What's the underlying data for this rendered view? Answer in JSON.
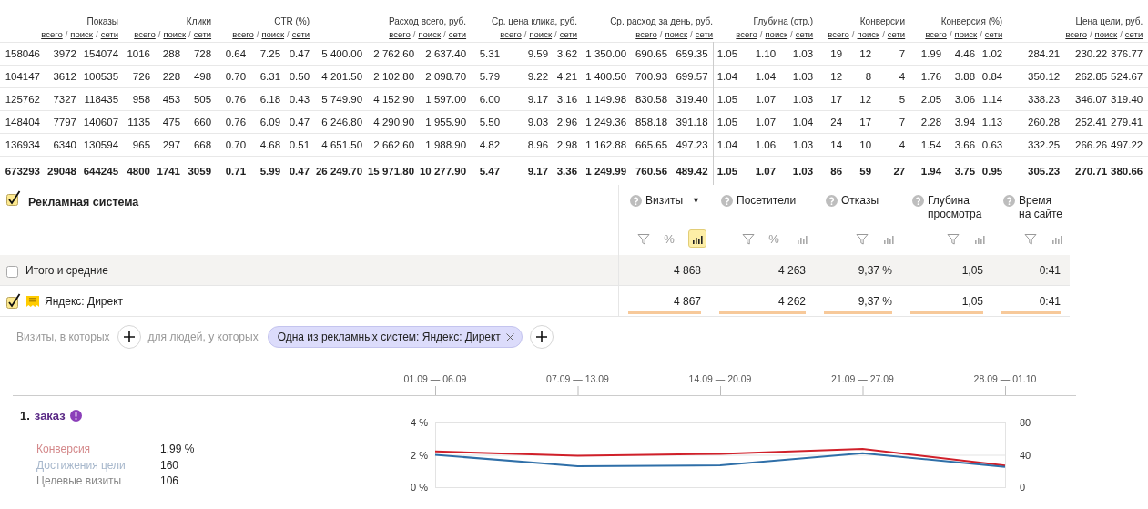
{
  "top_table": {
    "groups": [
      {
        "title": "Показы",
        "links": [
          "всего",
          "поиск",
          "сети"
        ],
        "separators": [
          "/",
          "/"
        ]
      },
      {
        "title": "Клики",
        "links": [
          "всего",
          "поиск",
          "сети"
        ],
        "separators": [
          "/",
          "/"
        ]
      },
      {
        "title": "CTR (%)",
        "links": [
          "всего",
          "поиск",
          "сети"
        ],
        "separators": [
          "/",
          "/"
        ]
      },
      {
        "title": "Расход всего, руб.",
        "links": [
          "всего",
          "поиск",
          "сети"
        ],
        "separators": [
          "/",
          "/"
        ]
      },
      {
        "title": "Ср. цена клика, руб.",
        "links": [
          "всего",
          "поиск",
          "сети"
        ],
        "separators": [
          "/",
          "/"
        ]
      },
      {
        "title": "Ср. расход за день, руб.",
        "links": [
          "всего",
          "поиск",
          "сети"
        ],
        "separators": [
          "/",
          "/"
        ]
      },
      {
        "title": "Глубина (стр.)",
        "links": [
          "всего",
          "поиск",
          "сети"
        ],
        "separators": [
          "/",
          "/"
        ]
      },
      {
        "title": "Конверсии",
        "links": [
          "всего",
          "поиск",
          "сети"
        ],
        "separators": [
          "/",
          "/"
        ]
      },
      {
        "title": "Конверсия (%)",
        "links": [
          "всего",
          "поиск",
          "сети"
        ],
        "separators": [
          "/",
          "/"
        ]
      },
      {
        "title": "Цена цели, руб.",
        "links": [
          "всего",
          "поиск",
          "сети"
        ],
        "separators": [
          "/",
          "/"
        ]
      }
    ],
    "rows": [
      {
        "kind": "data",
        "cells": [
          "158046",
          "3972",
          "154074",
          "1016",
          "288",
          "728",
          "0.64",
          "7.25",
          "0.47",
          "5 400.00",
          "2 762.60",
          "2 637.40",
          "5.31",
          "9.59",
          "3.62",
          "1 350.00",
          "690.65",
          "659.35",
          "1.05",
          "1.10",
          "1.03",
          "19",
          "12",
          "7",
          "1.99",
          "4.46",
          "1.02",
          "284.21",
          "230.22",
          "376.77"
        ]
      },
      {
        "kind": "data",
        "cells": [
          "104147",
          "3612",
          "100535",
          "726",
          "228",
          "498",
          "0.70",
          "6.31",
          "0.50",
          "4 201.50",
          "2 102.80",
          "2 098.70",
          "5.79",
          "9.22",
          "4.21",
          "1 400.50",
          "700.93",
          "699.57",
          "1.04",
          "1.04",
          "1.03",
          "12",
          "8",
          "4",
          "1.76",
          "3.88",
          "0.84",
          "350.12",
          "262.85",
          "524.67"
        ]
      },
      {
        "kind": "data",
        "cells": [
          "125762",
          "7327",
          "118435",
          "958",
          "453",
          "505",
          "0.76",
          "6.18",
          "0.43",
          "5 749.90",
          "4 152.90",
          "1 597.00",
          "6.00",
          "9.17",
          "3.16",
          "1 149.98",
          "830.58",
          "319.40",
          "1.05",
          "1.07",
          "1.03",
          "17",
          "12",
          "5",
          "2.05",
          "3.06",
          "1.14",
          "338.23",
          "346.07",
          "319.40"
        ]
      },
      {
        "kind": "data",
        "cells": [
          "148404",
          "7797",
          "140607",
          "1135",
          "475",
          "660",
          "0.76",
          "6.09",
          "0.47",
          "6 246.80",
          "4 290.90",
          "1 955.90",
          "5.50",
          "9.03",
          "2.96",
          "1 249.36",
          "858.18",
          "391.18",
          "1.05",
          "1.07",
          "1.04",
          "24",
          "17",
          "7",
          "2.28",
          "3.94",
          "1.13",
          "260.28",
          "252.41",
          "279.41"
        ]
      },
      {
        "kind": "data",
        "cells": [
          "136934",
          "6340",
          "130594",
          "965",
          "297",
          "668",
          "0.70",
          "4.68",
          "0.51",
          "4 651.50",
          "2 662.60",
          "1 988.90",
          "4.82",
          "8.96",
          "2.98",
          "1 162.88",
          "665.65",
          "497.23",
          "1.04",
          "1.06",
          "1.03",
          "14",
          "10",
          "4",
          "1.54",
          "3.66",
          "0.63",
          "332.25",
          "266.26",
          "497.22"
        ]
      },
      {
        "kind": "total",
        "cells": [
          "673293",
          "29048",
          "644245",
          "4800",
          "1741",
          "3059",
          "0.71",
          "5.99",
          "0.47",
          "26 249.70",
          "15 971.80",
          "10 277.90",
          "5.47",
          "9.17",
          "3.36",
          "1 249.99",
          "760.56",
          "489.42",
          "1.05",
          "1.07",
          "1.03",
          "86",
          "59",
          "27",
          "1.94",
          "3.75",
          "0.95",
          "305.23",
          "270.71",
          "380.66"
        ]
      }
    ]
  },
  "report": {
    "dimension": {
      "label": "Рекламная система",
      "checked": true
    },
    "metrics": [
      {
        "title": "Визиты",
        "sort_indicator": "▼",
        "percent": "%",
        "chart_selected": true
      },
      {
        "title": "Посетители",
        "percent": "%",
        "chart_selected": false
      },
      {
        "title": "Отказы",
        "chart_selected": false
      },
      {
        "title": "Глубина просмотра",
        "chart_selected": false
      },
      {
        "title": "Время на сайте",
        "chart_selected": false
      }
    ],
    "rows": [
      {
        "kind": "total",
        "label": "Итого и средние",
        "checked": false,
        "values": [
          "4 868",
          "4 263",
          "9,37 %",
          "1,05",
          "0:41"
        ]
      },
      {
        "kind": "source",
        "label": "Яндекс: Директ",
        "checked": true,
        "values": [
          "4 867",
          "4 262",
          "9,37 %",
          "1,05",
          "0:41"
        ]
      }
    ]
  },
  "segment": {
    "visits_label": "Визиты, в которых",
    "people_label": "для людей, у которых",
    "chips": [
      {
        "text": "Одна из рекламных систем: Яндекс: Директ"
      }
    ]
  },
  "goal": {
    "number": "1.",
    "name": "заказ",
    "stats": [
      {
        "label": "Конверсия",
        "value": "1,99 %",
        "color": "#d4898b"
      },
      {
        "label": "Достижения цели",
        "value": "160",
        "color": "#a8b8cc"
      },
      {
        "label": "Целевые визиты",
        "value": "106",
        "color": "#888888"
      }
    ],
    "chart_data": {
      "type": "line",
      "categories": [
        "01.09 — 06.09",
        "07.09 — 13.09",
        "14.09 — 20.09",
        "21.09 — 27.09",
        "28.09 — 01.10"
      ],
      "series": [
        {
          "color": "#d0202a",
          "values": [
            2.21,
            1.94,
            2.06,
            2.36,
            1.34
          ]
        },
        {
          "color": "#2f6fa8",
          "axis": "y2",
          "values": [
            40,
            26,
            27,
            42,
            25
          ]
        }
      ],
      "ylim": [
        0,
        4
      ],
      "yticks": [
        {
          "value": 0,
          "label": "0 %"
        },
        {
          "value": 2,
          "label": "2 %"
        },
        {
          "value": 4,
          "label": "4 %"
        }
      ],
      "y2lim": [
        0,
        80
      ],
      "y2ticks": [
        0,
        40,
        80
      ]
    }
  }
}
